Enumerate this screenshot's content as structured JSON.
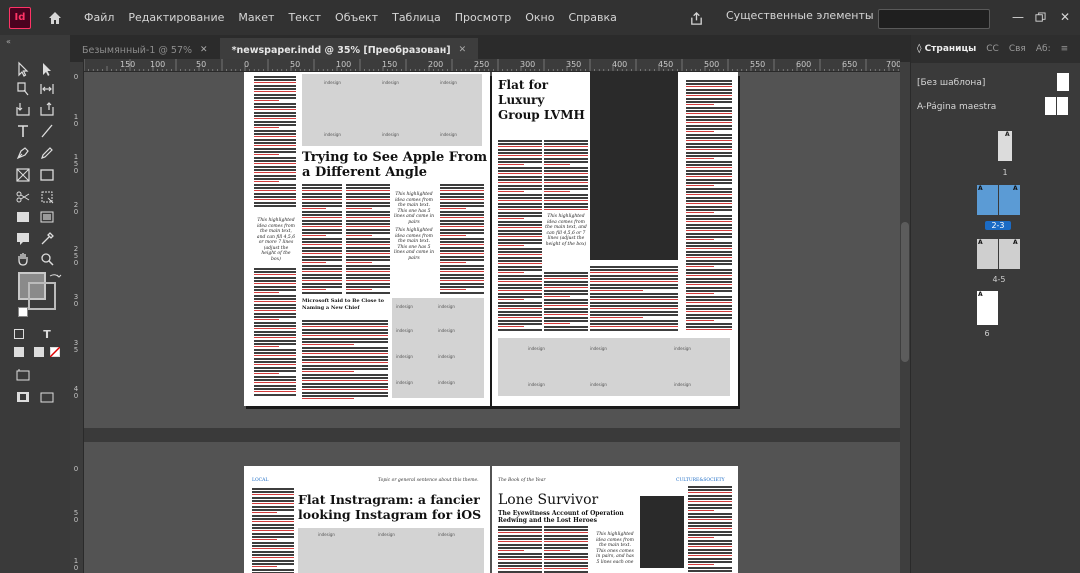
{
  "app": {
    "logo_text": "Id"
  },
  "menu": {
    "items": [
      "Файл",
      "Редактирование",
      "Макет",
      "Текст",
      "Объект",
      "Таблица",
      "Просмотр",
      "Окно",
      "Справка"
    ],
    "workspace": "Существенные элементы"
  },
  "tabs": [
    {
      "label": "Безымянный-1 @ 57%",
      "active": false
    },
    {
      "label": "*newspaper.indd @ 35% [Преобразован]",
      "active": true
    }
  ],
  "hruler": [
    "150",
    "100",
    "50",
    "0",
    "50",
    "100",
    "150",
    "200",
    "250",
    "300",
    "350",
    "400",
    "450",
    "500",
    "550",
    "600",
    "650",
    "700"
  ],
  "vruler": [
    "0",
    "1 0",
    "1 5 0",
    "2 0",
    "2 5 0",
    "3 0",
    "3 5",
    "4 0",
    "0",
    "5 0",
    "1 0"
  ],
  "pages": {
    "headline_apple": "Trying to See Apple From a Different Angle",
    "headline_lvmh": "Flat for Luxury Group LVMH",
    "headline_microsoft": "Microsoft Said to Be Close to Naming a New Chief",
    "pull_quote": "This highlighted idea comes from the main text. This one has 5 lines and come in pairs",
    "pull_quote_left": "This highlighted idea comes from the main text, and can fill 4,5,6 or more 7 lines (adjust the height of the box)",
    "pull_quote_lvmh": "This highlighted idea comes from the main text, and can fill 4,5,6 or 7 lines (adjust the height of the box)",
    "logo_word": "indesign",
    "label_local": "LOCAL",
    "label_topic": "Topic or general sentence about this theme.",
    "headline_instagram": "Flat Instragram: a fancier looking Instagram for iOS",
    "label_book": "The Book of the Year",
    "label_culture": "CULTURE&SOCIETY",
    "headline_survivor": "Lone Survivor",
    "subhead_survivor": "The Eyewitness Account of Operation Redwing and the Lost Heroes",
    "pull_quote_survivor": "This highlighted idea comes from the main text. This ones comes in pairs, and has 5 lines each one"
  },
  "panel": {
    "tabs": [
      {
        "label": "◊ Страницы",
        "active": true
      },
      {
        "label": "CC",
        "active": false
      },
      {
        "label": "Свя",
        "active": false
      },
      {
        "label": "Аб:",
        "active": false
      }
    ],
    "no_master": "[Без шаблона]",
    "master_a": "A-Página maestra",
    "page_labels": [
      "1",
      "2-3",
      "4-5",
      "6"
    ],
    "master_letter": "A"
  },
  "colors": {
    "accent": "#1b6bc5",
    "app_logo": "#ff3366"
  }
}
